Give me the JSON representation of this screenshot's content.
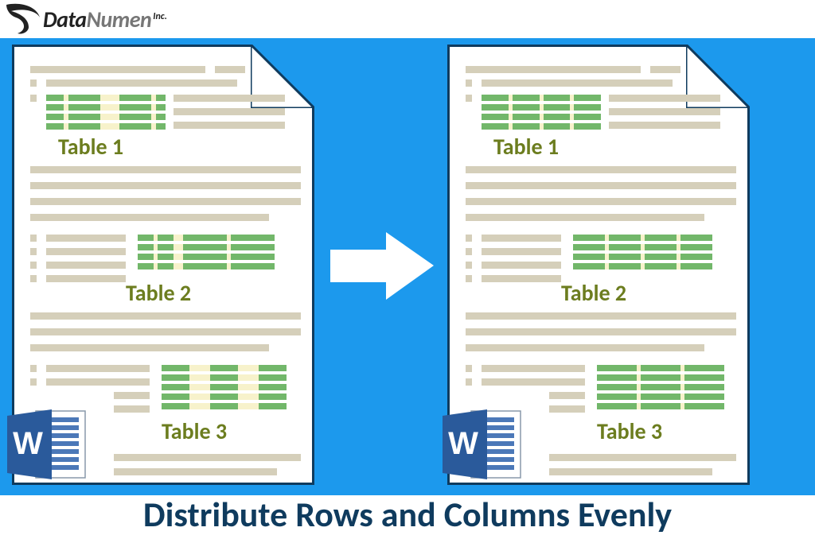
{
  "logo": {
    "part1": "Data",
    "part2": "Numen",
    "inc": "Inc."
  },
  "left_page": {
    "table1_label": "Table 1",
    "table2_label": "Table 2",
    "table3_label": "Table 3"
  },
  "right_page": {
    "table1_label": "Table 1",
    "table2_label": "Table 2",
    "table3_label": "Table 3"
  },
  "caption": "Distribute Rows and Columns Evenly",
  "colors": {
    "blue_bg": "#1c99ed",
    "page_border": "#0f3b5e",
    "line": "#d5cfba",
    "cell_green": "#72b76a",
    "cell_gap": "#f7f2cb",
    "label": "#6c7d1f",
    "word_blue": "#2a5a9b"
  }
}
